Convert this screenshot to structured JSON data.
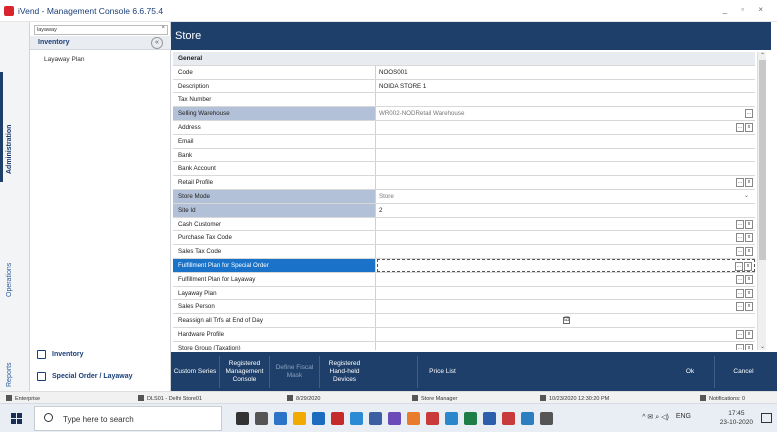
{
  "window": {
    "title": "iVend - Management Console 6.6.75.4",
    "controls": "_ ▫ ×"
  },
  "side_tabs": {
    "administration": "Administration",
    "operations": "Operations",
    "reports": "Reports"
  },
  "tree": {
    "search_value": "layaway",
    "search_clear": "×",
    "header": "Inventory",
    "items": [
      "Layaway Plan"
    ],
    "nav_inventory": "Inventory",
    "nav_special_order": "Special Order / Layaway"
  },
  "page": {
    "title": "Store"
  },
  "grid": {
    "section": "General",
    "rows": [
      {
        "label": "Code",
        "value": "NOOS001"
      },
      {
        "label": "Description",
        "value": "NOIDA STORE 1"
      },
      {
        "label": "Tax Number",
        "value": ""
      },
      {
        "label": "Selling Warehouse",
        "value": "WR002-NODRetail Warehouse"
      },
      {
        "label": "Address",
        "value": ""
      },
      {
        "label": "Email",
        "value": ""
      },
      {
        "label": "Bank",
        "value": ""
      },
      {
        "label": "Bank Account",
        "value": ""
      },
      {
        "label": "Retail Profile",
        "value": ""
      },
      {
        "label": "Store Mode",
        "value": "Store"
      },
      {
        "label": "Site Id",
        "value": "2"
      },
      {
        "label": "Cash Customer",
        "value": ""
      },
      {
        "label": "Purchase Tax Code",
        "value": ""
      },
      {
        "label": "Sales Tax Code",
        "value": ""
      },
      {
        "label": "Fulfillment Plan for Special Order",
        "value": ""
      },
      {
        "label": "Fulfillment Plan for Layaway",
        "value": ""
      },
      {
        "label": "Layaway Plan",
        "value": ""
      },
      {
        "label": "Sales Person",
        "value": ""
      },
      {
        "label": "Reassign all Trfs at End of Day",
        "value": "☑"
      },
      {
        "label": "Hardware Profile",
        "value": ""
      },
      {
        "label": "Store Group (Taxation)",
        "value": ""
      }
    ],
    "ellipsis": "...",
    "clear": "x",
    "dropdown": "⌄"
  },
  "toolbar": {
    "custom_series": "Custom Series",
    "registered_console": "Registered Management Console",
    "define_fiscal_mask": "Define Fiscal Mask",
    "registered_handheld": "Registered Hand-held Devices",
    "price_list": "Price List",
    "ok": "Ok",
    "cancel": "Cancel"
  },
  "status": {
    "enterprise": "Enterprise",
    "store": "DLS01 - Delhi Store01",
    "date": "8/29/2020",
    "role": "Store Manager",
    "datetime": "10/23/2020 12:30:20 PM",
    "notifications": "Notifications: 0"
  },
  "taskbar": {
    "search_placeholder": "Type here to search",
    "lang": "ENG",
    "time": "17:45",
    "date": "23-10-2020",
    "tray": "^ ✉ ⌕ ◁)"
  },
  "colors": {
    "navy": "#1d3f69",
    "selected": "#1a73c8",
    "highlight": "#b3c1d8"
  }
}
